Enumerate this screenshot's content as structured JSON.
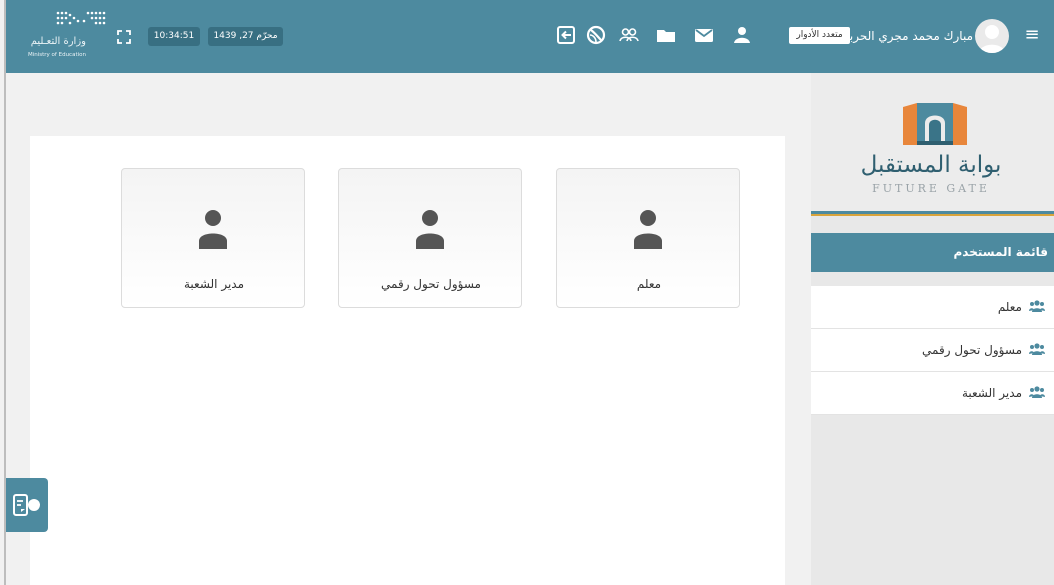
{
  "colors": {
    "primary": "#4d8a9f",
    "primary_dark": "#386f82",
    "accent_gold": "#d9a43b",
    "logo_orange": "#e8863b"
  },
  "header": {
    "user_name": "مبارك محمد مجري الحربي",
    "role_badge": "متعدد الأدوار",
    "date": "محرّم 27, 1439",
    "time": "10:34:51",
    "icons": [
      "menu-icon",
      "user-icon",
      "mail-icon",
      "folder-icon",
      "group-icon",
      "globe-icon",
      "logout-icon",
      "fullscreen-icon"
    ],
    "ministry_logo": {
      "arabic": "وزارة التعـليم",
      "english": "Ministry of Education"
    }
  },
  "sidebar": {
    "logo": {
      "arabic": "بوابة المستقبل",
      "english": "FUTURE GATE"
    },
    "menu_title": "قائمة المستخدم",
    "items": [
      {
        "label": "معلم",
        "icon": "users-icon"
      },
      {
        "label": "مسؤول تحول رقمي",
        "icon": "users-icon"
      },
      {
        "label": "مدير الشعبة",
        "icon": "users-icon"
      }
    ]
  },
  "main": {
    "role_cards": [
      {
        "label": "معلم",
        "icon": "user-icon"
      },
      {
        "label": "مسؤول تحول رقمي",
        "icon": "user-icon"
      },
      {
        "label": "مدير الشعبة",
        "icon": "user-icon"
      }
    ]
  },
  "help_button": {
    "icon": "support-icon"
  }
}
